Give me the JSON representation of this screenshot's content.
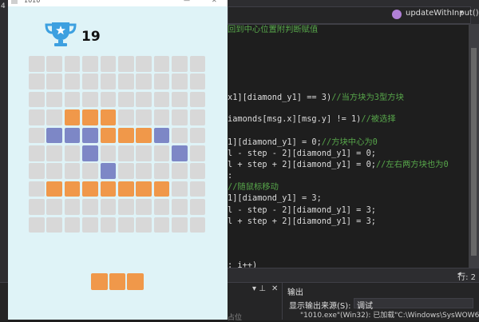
{
  "game": {
    "window_title": "1010",
    "score": "19",
    "board": {
      "rows": 10,
      "cols": 10,
      "cells": [
        "..........",
        "..........",
        "..........",
        "..ooo.....",
        ".bbbooob..",
        "...b....b.",
        "....b.....",
        ".ooooooo..",
        "..........",
        ".........."
      ]
    },
    "next_piece": {
      "shape": "horizontal-3",
      "color": "orange"
    }
  },
  "ide": {
    "nav": {
      "function": "updateWithInput()"
    },
    "left_char": "4",
    "code_lines": [
      {
        "code": "",
        "comment": "回到中心位置附判断赋值"
      },
      {
        "code": "x1][diamond_y1] == 3)",
        "comment": "//当方块为3型方块"
      },
      {
        "code": "iamonds[msg.x][msg.y] != 1)",
        "comment": "//被选择"
      },
      {
        "code": "1][diamond_y1] = 0;",
        "comment": "//方块中心为0"
      },
      {
        "code": "l - step - 2][diamond_y1] = 0;",
        "comment": ""
      },
      {
        "code": "l + step + 2][diamond_y1] = 0;",
        "comment": "//左右两方块也为0"
      },
      {
        "code": ":",
        "comment": ""
      },
      {
        "code": "",
        "comment": "//随鼠标移动"
      },
      {
        "code": "1][diamond_y1] = 3;",
        "comment": ""
      },
      {
        "code": "l - step - 2][diamond_y1] = 3;",
        "comment": ""
      },
      {
        "code": "l + step + 2][diamond_y1] = 3;",
        "comment": ""
      },
      {
        "code": "; i++)",
        "comment": ""
      }
    ],
    "status": {
      "row": "行: 2"
    },
    "output_panel": {
      "title": "输出",
      "source_label": "显示输出来源(S):",
      "source_value": "调试",
      "line": "\"1010.exe\"(Win32): 已加载\"C:\\Windows\\SysWOW64\\LoreUiCo"
    },
    "left_panel_text": "占位"
  }
}
